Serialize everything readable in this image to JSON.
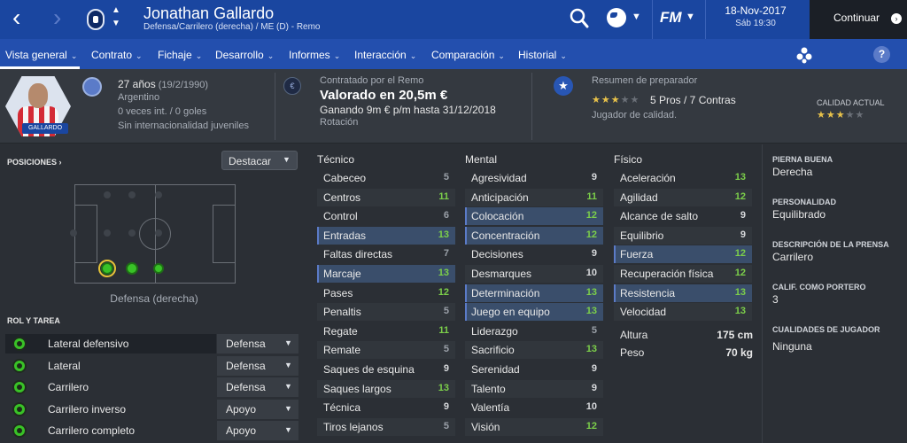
{
  "header": {
    "player_name": "Jonathan Gallardo",
    "player_subtitle": "Defensa/Carrilero (derecha) / ME (D) - Remo",
    "date": "18-Nov-2017",
    "day_time": "Sáb 19:30",
    "continue_label": "Continuar",
    "game_logo": "FM"
  },
  "menu": {
    "items": [
      {
        "label": "Vista general"
      },
      {
        "label": "Contrato"
      },
      {
        "label": "Fichaje"
      },
      {
        "label": "Desarrollo"
      },
      {
        "label": "Informes"
      },
      {
        "label": "Interacción"
      },
      {
        "label": "Comparación"
      },
      {
        "label": "Historial"
      }
    ],
    "active": "Vista general",
    "help_label": "?"
  },
  "profile": {
    "age": "27 años",
    "birth_date": "(19/2/1990)",
    "nationality": "Argentino",
    "caps": "0 veces int. / 0 goles",
    "youth": "Sin internacionalidad juveniles",
    "portrait_tag": "GALLARDO"
  },
  "contract": {
    "contracted_by": "Contratado por el Remo",
    "value": "Valorado en 20,5m €",
    "wage": "Ganando 9m € p/m hasta 31/12/2018",
    "status": "Rotación",
    "currency_icon": "€"
  },
  "coach_report": {
    "title": "Resumen de preparador",
    "stars_filled": 3,
    "stars_total": 5,
    "pros_cons": "5 Pros / 7 Contras",
    "summary": "Jugador de calidad.",
    "current_ability_label": "CALIDAD ACTUAL",
    "current_ability_stars": 3
  },
  "positions": {
    "label": "POSICIONES",
    "highlight_button": "Destacar",
    "position_name": "Defensa (derecha)",
    "roles_label": "ROL Y TAREA",
    "roles": [
      {
        "name": "Lateral defensivo",
        "duty": "Defensa"
      },
      {
        "name": "Lateral",
        "duty": "Defensa"
      },
      {
        "name": "Carrilero",
        "duty": "Defensa"
      },
      {
        "name": "Carrilero inverso",
        "duty": "Apoyo"
      },
      {
        "name": "Carrilero completo",
        "duty": "Apoyo"
      }
    ]
  },
  "attributes": {
    "technical_label": "Técnico",
    "mental_label": "Mental",
    "physical_label": "Físico",
    "technical": [
      {
        "name": "Cabeceo",
        "value": "5"
      },
      {
        "name": "Centros",
        "value": "11"
      },
      {
        "name": "Control",
        "value": "6"
      },
      {
        "name": "Entradas",
        "value": "13"
      },
      {
        "name": "Faltas directas",
        "value": "7"
      },
      {
        "name": "Marcaje",
        "value": "13"
      },
      {
        "name": "Pases",
        "value": "12"
      },
      {
        "name": "Penaltis",
        "value": "5"
      },
      {
        "name": "Regate",
        "value": "11"
      },
      {
        "name": "Remate",
        "value": "5"
      },
      {
        "name": "Saques de esquina",
        "value": "9"
      },
      {
        "name": "Saques largos",
        "value": "13"
      },
      {
        "name": "Técnica",
        "value": "9"
      },
      {
        "name": "Tiros lejanos",
        "value": "5"
      }
    ],
    "mental": [
      {
        "name": "Agresividad",
        "value": "9"
      },
      {
        "name": "Anticipación",
        "value": "11"
      },
      {
        "name": "Colocación",
        "value": "12"
      },
      {
        "name": "Concentración",
        "value": "12"
      },
      {
        "name": "Decisiones",
        "value": "9"
      },
      {
        "name": "Desmarques",
        "value": "10"
      },
      {
        "name": "Determinación",
        "value": "13"
      },
      {
        "name": "Juego en equipo",
        "value": "13"
      },
      {
        "name": "Liderazgo",
        "value": "5"
      },
      {
        "name": "Sacrificio",
        "value": "13"
      },
      {
        "name": "Serenidad",
        "value": "9"
      },
      {
        "name": "Talento",
        "value": "9"
      },
      {
        "name": "Valentía",
        "value": "10"
      },
      {
        "name": "Visión",
        "value": "12"
      }
    ],
    "physical": [
      {
        "name": "Aceleración",
        "value": "13"
      },
      {
        "name": "Agilidad",
        "value": "12"
      },
      {
        "name": "Alcance de salto",
        "value": "9"
      },
      {
        "name": "Equilibrio",
        "value": "9"
      },
      {
        "name": "Fuerza",
        "value": "12"
      },
      {
        "name": "Recuperación física",
        "value": "12"
      },
      {
        "name": "Resistencia",
        "value": "13"
      },
      {
        "name": "Velocidad",
        "value": "13"
      }
    ],
    "height_label": "Altura",
    "height_value": "175 cm",
    "weight_label": "Peso",
    "weight_value": "70 kg"
  },
  "details": {
    "foot_label": "PIERNA BUENA",
    "foot_value": "Derecha",
    "personality_label": "PERSONALIDAD",
    "personality_value": "Equilibrado",
    "media_label": "DESCRIPCIÓN DE LA PRENSA",
    "media_value": "Carrilero",
    "gk_label": "CALIF. COMO PORTERO",
    "gk_value": "3",
    "traits_label": "CUALIDADES DE JUGADOR",
    "traits_value": "Ninguna"
  },
  "colors": {
    "topbar": "#1a46a0",
    "menubar": "#234fae",
    "background": "#2b2f35",
    "attr_good": "#7ccf4a",
    "star": "#e8c24a"
  },
  "icons": {
    "back": "chevron-left-icon",
    "forward": "chevron-right-icon",
    "search": "search-icon",
    "globe": "globe-icon",
    "help": "help-icon"
  }
}
